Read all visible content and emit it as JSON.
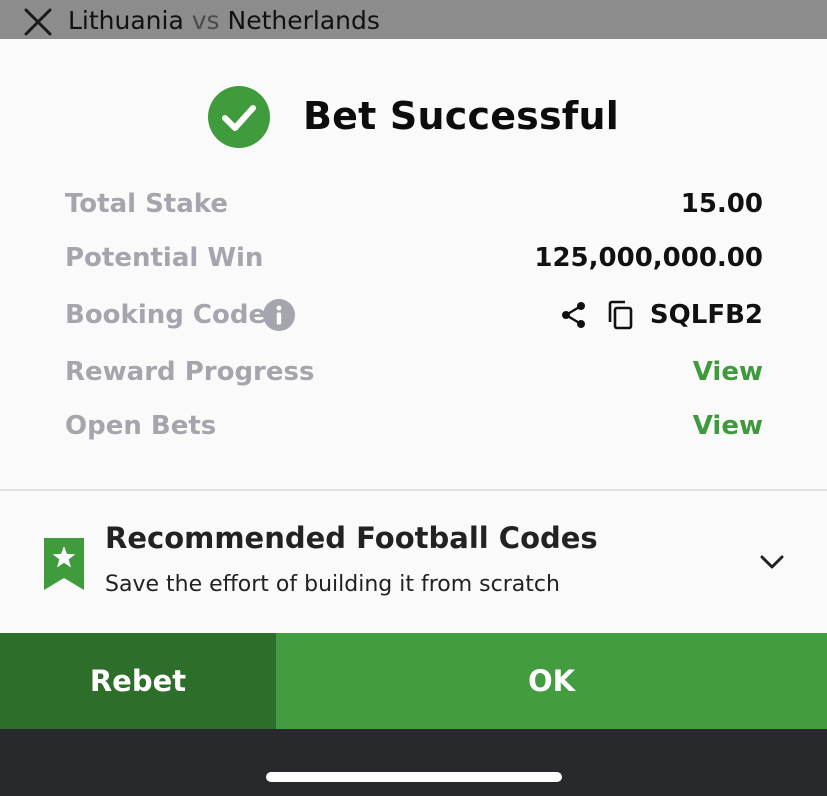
{
  "header": {
    "home_team": "Lithuania",
    "vs": "vs",
    "away_team": "Netherlands",
    "close_icon": "close-icon"
  },
  "status": {
    "title": "Bet Successful",
    "icon": "check-circle-icon",
    "color": "#3f9b3b"
  },
  "details": {
    "total_stake_label": "Total Stake",
    "total_stake_value": "15.00",
    "potential_win_label": "Potential Win",
    "potential_win_value": "125,000,000.00",
    "booking_code_label": "Booking Code",
    "booking_code_value": "SQLFB2",
    "reward_progress_label": "Reward Progress",
    "reward_progress_action": "View",
    "open_bets_label": "Open Bets",
    "open_bets_action": "View"
  },
  "recommended": {
    "title": "Recommended Football Codes",
    "subtitle": "Save the effort of building it from scratch",
    "icon": "bookmark-star-icon"
  },
  "actions": {
    "rebet_label": "Rebet",
    "ok_label": "OK"
  },
  "colors": {
    "accent_green": "#449c41",
    "dark_green": "#2e6e2b",
    "link_green": "#3e9a3c"
  }
}
